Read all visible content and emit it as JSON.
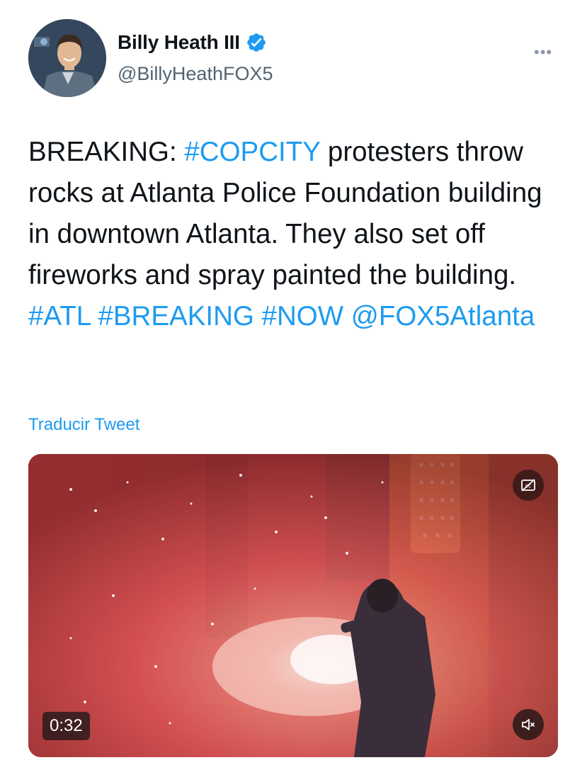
{
  "author": {
    "display_name": "Billy Heath III",
    "handle": "@BillyHeathFOX5",
    "verified": true,
    "avatar_icon": "profile-photo",
    "more_icon": "more-horizontal-icon"
  },
  "tweet": {
    "segments": [
      {
        "text": "BREAKING: ",
        "type": "text"
      },
      {
        "text": "#COPCITY",
        "type": "hashtag"
      },
      {
        "text": " protesters throw rocks at Atlanta Police Foundation building in downtown Atlanta. They also set off fireworks and spray painted the building. ",
        "type": "text"
      },
      {
        "text": "#ATL",
        "type": "hashtag"
      },
      {
        "text": " ",
        "type": "text"
      },
      {
        "text": "#BREAKING",
        "type": "hashtag"
      },
      {
        "text": " ",
        "type": "text"
      },
      {
        "text": "#NOW",
        "type": "hashtag"
      },
      {
        "text": " ",
        "type": "text"
      },
      {
        "text": "@FOX5Atlanta",
        "type": "mention"
      }
    ],
    "translate_label": "Traducir Tweet"
  },
  "video": {
    "duration": "0:32",
    "cc_icon": "closed-captions-icon",
    "mute_icon": "muted-speaker-icon"
  },
  "colors": {
    "link": "#1d9bf0",
    "text": "#0f1419",
    "secondary": "#536471",
    "verified": "#1d9bf0"
  }
}
